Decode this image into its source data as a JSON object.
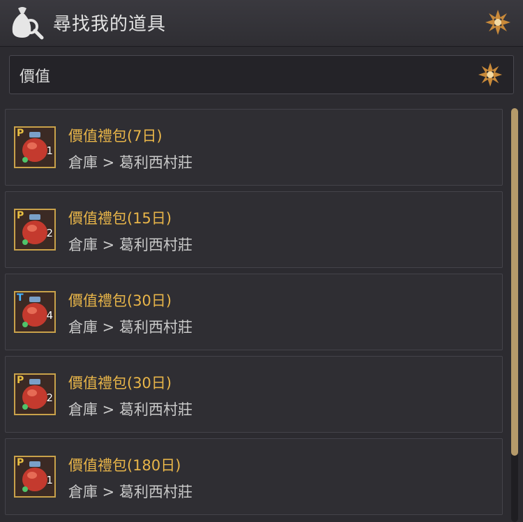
{
  "header": {
    "title": "尋找我的道具",
    "icon": "money-bag-search-icon",
    "close_icon": "ornate-star-close-icon"
  },
  "search": {
    "value": "價值",
    "clear_icon": "ornate-star-clear-icon"
  },
  "results": [
    {
      "grade": "P",
      "quantity": "1",
      "name": "價值禮包(7日)",
      "location": "倉庫 > 葛利西村莊"
    },
    {
      "grade": "P",
      "quantity": "2",
      "name": "價值禮包(15日)",
      "location": "倉庫 > 葛利西村莊"
    },
    {
      "grade": "T",
      "quantity": "4",
      "name": "價值禮包(30日)",
      "location": "倉庫 > 葛利西村莊"
    },
    {
      "grade": "P",
      "quantity": "2",
      "name": "價值禮包(30日)",
      "location": "倉庫 > 葛利西村莊"
    },
    {
      "grade": "P",
      "quantity": "1",
      "name": "價值禮包(180日)",
      "location": "倉庫 > 葛利西村莊"
    }
  ],
  "colors": {
    "item_name": "#e8b549",
    "grade_p": "#e8c043",
    "grade_t": "#47b4ff",
    "accent_gold": "#c9a24a"
  }
}
